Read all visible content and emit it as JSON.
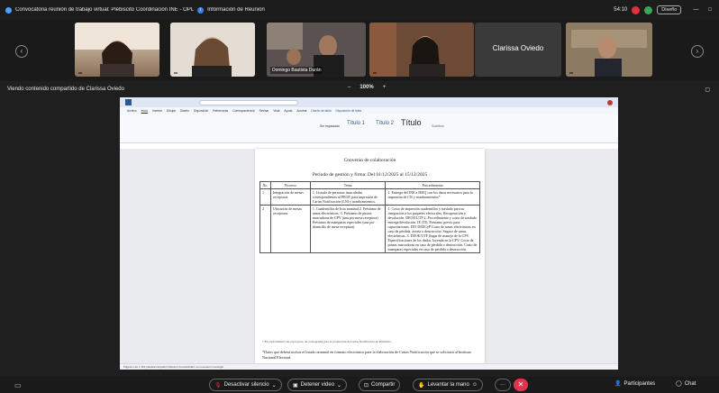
{
  "titlebar": {
    "meeting_title": "Convocatoria reunión de trabajo virtual: Plebiscito Coordinación INE - OPL",
    "meeting_info": "Información de Reunión",
    "clock": "54:10",
    "view_label": "Diseño",
    "rec_color_1": "#e0313a",
    "rec_color_2": "#3ea35a"
  },
  "participants": [
    {
      "name": ""
    },
    {
      "name": ""
    },
    {
      "name": "Domingo Bautista Durán"
    },
    {
      "name": ""
    },
    {
      "name": "Clarissa Oviedo"
    },
    {
      "name": ""
    }
  ],
  "share": {
    "label": "Viendo contenido compartido de Clarissa Oviedo",
    "zoom_out": "–",
    "zoom_value": "100%",
    "zoom_in": "+"
  },
  "word": {
    "tabs": [
      "Archivo",
      "Inicio",
      "Insertar",
      "Dibujar",
      "Diseño",
      "Disposición",
      "Referencias",
      "Correspondencia",
      "Revisar",
      "Vista",
      "Ayuda",
      "Acrobat",
      "Diseño de tabla",
      "Disposición de tabla"
    ],
    "styles": [
      "Sin espaciado",
      "Título 1",
      "Título 2",
      "Título",
      "Subtítulo"
    ],
    "doc_title": "Convenio de colaboración",
    "doc_period": "Periodo de gestión y firma: Del 01/12/2025 al 15/12/2025",
    "table_headers": [
      "No.",
      "Proceso",
      "Tema",
      "Procedimiento"
    ],
    "rows": [
      {
        "no": "1",
        "proceso": "Integración de mesas receptoras",
        "tema": "1. Listado de personas insaculadas correspondientes al PEOF, para impresión de Cartas Notificación (LNI y nombramientos.",
        "procedimiento": "1. Entrega del INE a IEEQ con los datos necesarios para la impresión de CN y nombramientos*"
      },
      {
        "no": "2",
        "proceso": "Ubicación de mesas receptoras",
        "tema": "1. Cuadernillos de lista nominal 2. Préstamo de urnas electrónicas. 3. Préstamo de pinzas marcadoras de CPV (una por mesa receptora) Préstamo de mamparas especiales (una por domicilio de mesa receptora)",
        "procedimiento": "1. Costo de impresión cuadernillos y traslado para su integración a los paquetes electorales. Recuperación y devolución. DEOE/UTF 2. Procedimiento y costo de traslado entrega/devolución. IE (TI). Préstamo previo para capacitaciones. DTI DEECyP Costo de urnas electrónicas en caso de pérdida, avería o destrucción. Seguro de urnas electrónicas. 3. DEOE/UTF (lugar de manejo de la CPV. Especificaciones de los dados, leyenda en la CPV. Costo de pinzas marcadoras en caso de pérdida o destrucción. Costo de mamparas especiales en caso de pérdida o destrucción."
      }
    ],
    "footnote": "* En conformidad con el proyecto de cronograma para la producción de Cartas Notificación de Plebiscito.",
    "note": "*Datos que deberá incluir el listado nominal en formato electrónico para la elaboración de Cartas Notificación que se solicitará al Instituto Nacional Electoral.",
    "status": "Página 1 de 1    315 palabras    Español (México)    Accesibilidad: es necesario investigar"
  },
  "controls": {
    "mute": "Desactivar silencio",
    "video": "Detener video",
    "share": "Compartir",
    "hand": "Levantar la mano",
    "participants": "Participantes",
    "chat": "Chat"
  }
}
